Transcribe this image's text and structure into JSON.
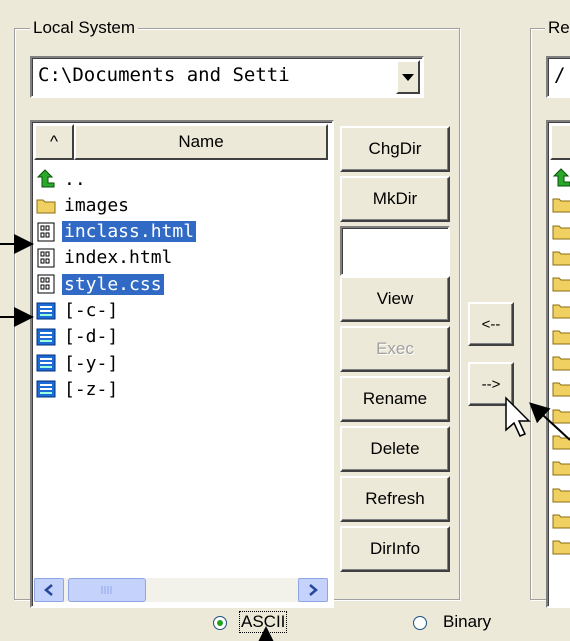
{
  "local_group": {
    "label": "Local System"
  },
  "remote_group": {
    "label_partial": "Re"
  },
  "local_path": {
    "value": "C:\\Documents and Setti"
  },
  "remote_path": {
    "value_partial": "/"
  },
  "list_header": {
    "sort": "^",
    "name": "Name"
  },
  "files": [
    {
      "name": "..",
      "icon": "up-folder-icon",
      "selected": false
    },
    {
      "name": "images",
      "icon": "folder-icon",
      "selected": false
    },
    {
      "name": "inclass.html",
      "icon": "file-icon",
      "selected": true
    },
    {
      "name": "index.html",
      "icon": "file-icon",
      "selected": false
    },
    {
      "name": "style.css",
      "icon": "file-icon",
      "selected": true
    },
    {
      "name": "[-c-]",
      "icon": "drive-icon",
      "selected": false
    },
    {
      "name": "[-d-]",
      "icon": "drive-icon",
      "selected": false
    },
    {
      "name": "[-y-]",
      "icon": "drive-icon",
      "selected": false
    },
    {
      "name": "[-z-]",
      "icon": "drive-icon",
      "selected": false
    }
  ],
  "buttons": {
    "chgdir": "ChgDir",
    "mkdir": "MkDir",
    "view": "View",
    "exec": "Exec",
    "rename": "Rename",
    "delete": "Delete",
    "refresh": "Refresh",
    "dirinfo": "DirInfo"
  },
  "transfer": {
    "to_local": "<--",
    "to_remote": "-->"
  },
  "mode": {
    "ascii": "ASCII",
    "binary": "Binary",
    "selected": "ascii"
  },
  "colors": {
    "selection": "#316ac5",
    "face": "#ece9d8",
    "folder": "#f0d060",
    "drive": "#1e6bd6",
    "up_arrow": "#108010"
  }
}
